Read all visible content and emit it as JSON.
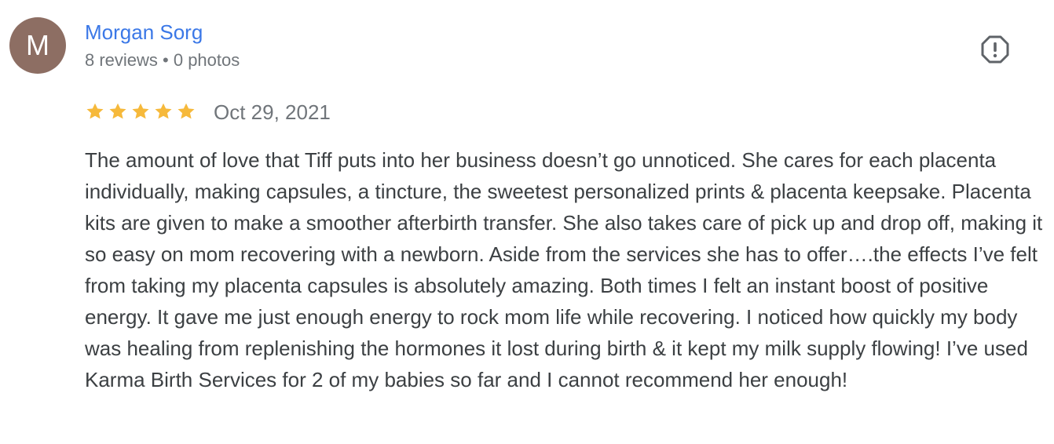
{
  "reviewer": {
    "initial": "M",
    "name": "Morgan Sorg",
    "meta": "8 reviews • 0 photos",
    "avatar_color": "#8d6e63"
  },
  "rating": {
    "stars": 5,
    "max": 5,
    "star_color": "#f6b93b"
  },
  "date": "Oct 29, 2021",
  "report_icon": "flag-alert-icon",
  "review_text": "The amount of love that Tiff puts into her business doesn’t go unnoticed. She cares for each placenta individually, making capsules, a tincture, the sweetest personalized prints & placenta keepsake. Placenta kits are given to make a smoother afterbirth transfer. She also takes care of pick up and drop off, making it so easy on mom recovering with a newborn. Aside from the services she has to offer….the effects I’ve felt from taking my placenta capsules is absolutely amazing. Both times I felt an instant boost of positive energy. It gave me just enough energy to rock mom life while recovering. I noticed how quickly my body was healing from replenishing the hormones it lost during birth & it kept my milk supply flowing! I’ve used Karma Birth Services for 2 of my babies so far and I cannot recommend her enough!",
  "colors": {
    "link": "#3b78e7",
    "secondary_text": "#70757a",
    "body_text": "#3c4043"
  }
}
